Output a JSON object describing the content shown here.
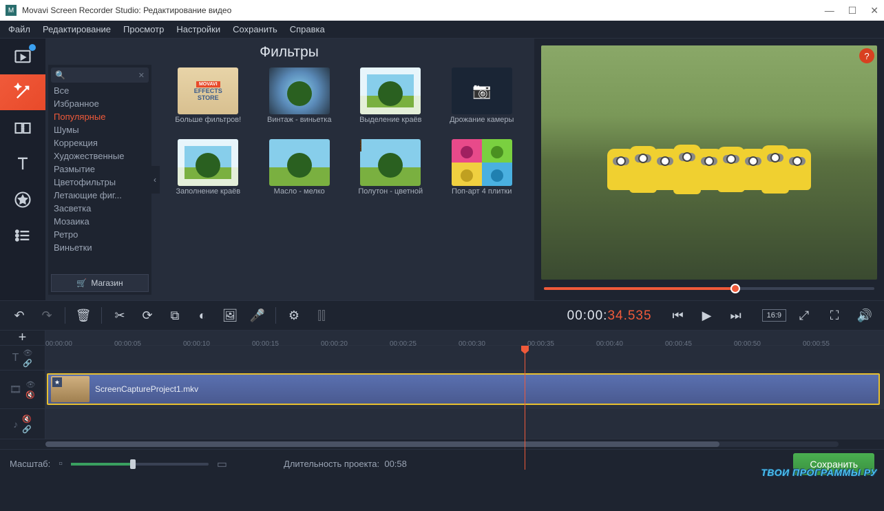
{
  "titlebar": {
    "title": "Movavi Screen Recorder Studio: Редактирование видео"
  },
  "menu": {
    "file": "Файл",
    "edit": "Редактирование",
    "view": "Просмотр",
    "settings": "Настройки",
    "save": "Сохранить",
    "help": "Справка"
  },
  "filters": {
    "title": "Фильтры",
    "search_placeholder": "",
    "categories": [
      "Все",
      "Избранное",
      "Популярные",
      "Шумы",
      "Коррекция",
      "Художественные",
      "Размытие",
      "Цветофильтры",
      "Летающие фиг...",
      "Засветка",
      "Мозаика",
      "Ретро",
      "Виньетки"
    ],
    "active_category_index": 2,
    "store_button": "Магазин",
    "thumbnails": [
      {
        "label": "Больше фильтров!"
      },
      {
        "label": "Винтаж - виньетка"
      },
      {
        "label": "Выделение краёв"
      },
      {
        "label": "Дрожание камеры"
      },
      {
        "label": "Заполнение краёв"
      },
      {
        "label": "Масло - мелко"
      },
      {
        "label": "Полутон - цветной"
      },
      {
        "label": "Поп-арт 4 плитки"
      }
    ]
  },
  "playback": {
    "timecode_prefix": "00:00:",
    "timecode_suffix": "34.535",
    "aspect": "16:9",
    "progress_percent": 58
  },
  "timeline": {
    "ruler": [
      "00:00:00",
      "00:00:05",
      "00:00:10",
      "00:00:15",
      "00:00:20",
      "00:00:25",
      "00:00:30",
      "00:00:35",
      "00:00:40",
      "00:00:45",
      "00:00:50",
      "00:00:55"
    ],
    "clip_name": "ScreenCaptureProject1.mkv"
  },
  "footer": {
    "zoom_label": "Масштаб:",
    "duration_label": "Длительность проекта:",
    "duration_value": "00:58",
    "save_button": "Сохранить"
  },
  "watermark": "ТВОИ ПРОГРАММЫ РУ"
}
